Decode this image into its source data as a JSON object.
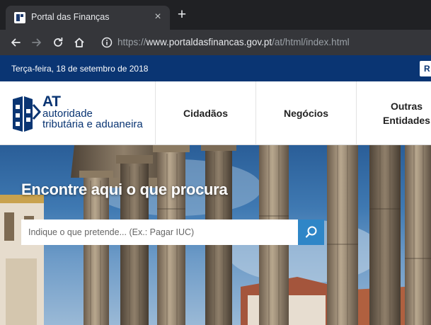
{
  "browser": {
    "tab": {
      "title": "Portal das Finanças",
      "close_glyph": "×",
      "favicon": "at-favicon-icon"
    },
    "new_tab_glyph": "+",
    "address": {
      "protocol": "https://",
      "host": "www.portaldasfinancas.gov.pt",
      "path": "/at/html/index.html"
    },
    "icons": [
      "back-arrow-icon",
      "forward-arrow-icon",
      "reload-icon",
      "home-icon",
      "info-icon"
    ],
    "colors": {
      "tabstrip": "#202124",
      "toolbar": "#35363a",
      "text": "#e8eaed",
      "muted": "#9aa0a6"
    }
  },
  "site": {
    "date": "Terça-feira, 18 de setembro de 2018",
    "login_label": "R",
    "logo": {
      "short": "AT",
      "line1": "autoridade",
      "line2": "tributária e aduaneira"
    },
    "nav": [
      {
        "label": "Cidadãos"
      },
      {
        "label": "Negócios"
      },
      {
        "label": "Outras Entidades"
      }
    ],
    "hero": {
      "title": "Encontre aqui o que procura",
      "search_placeholder": "Indique o que pretende... (Ex.: Pagar IUC)",
      "search_icon": "search-icon"
    },
    "colors": {
      "brand_blue": "#0a3573",
      "search_button": "#2f86c7",
      "nav_text": "#222222"
    }
  }
}
